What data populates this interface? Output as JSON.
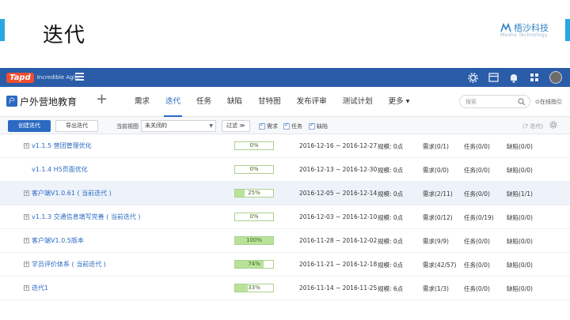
{
  "slide": {
    "title": "迭代",
    "brand_name": "梧沙科技",
    "brand_sub": "Mesha Technology"
  },
  "app": {
    "logo": "Tapd",
    "logo_tagline": "Incredible Agile",
    "project_icon": "户",
    "project_name": "户外营地教育",
    "plus": "+",
    "nav": [
      {
        "label": "需求",
        "active": false
      },
      {
        "label": "迭代",
        "active": true
      },
      {
        "label": "任务",
        "active": false
      },
      {
        "label": "缺陷",
        "active": false
      },
      {
        "label": "甘特图",
        "active": false
      },
      {
        "label": "发布评审",
        "active": false
      },
      {
        "label": "测试计划",
        "active": false
      },
      {
        "label": "更多 ▾",
        "active": false
      }
    ],
    "search_placeholder": "搜索",
    "guide": "⊙在线指引",
    "colors": {
      "topbar": "#2a5ca8",
      "accent": "#2a6ac2",
      "progress": "#b9e29a",
      "slide_accent": "#29a8e0"
    }
  },
  "toolbar": {
    "create_label": "创建迭代",
    "export_label": "导出迭代",
    "view_label": "当前视图",
    "view_value": "未关闭的",
    "filter_label": "过滤 ≫",
    "checks": [
      "需求",
      "任务",
      "缺陷"
    ],
    "count": "(7 迭代)"
  },
  "iterations": [
    {
      "name": "v1.1.5 营团管理优化",
      "expandable": true,
      "progress": "0%",
      "progress_value": 0,
      "dates": "2016-12-16 ~ 2016-12-27",
      "scale": "规模: 0点",
      "req": "需求(0/1)",
      "task": "任务(0/0)",
      "bug": "缺陷(0/0)",
      "highlight": false
    },
    {
      "name": "v1.1.4 H5页面优化",
      "expandable": false,
      "progress": "0%",
      "progress_value": 0,
      "dates": "2016-12-13 ~ 2016-12-30",
      "scale": "规模: 0点",
      "req": "需求(0/0)",
      "task": "任务(0/0)",
      "bug": "缺陷(0/0)",
      "highlight": false
    },
    {
      "name": "客户端V1.0.61 ( 当前迭代 )",
      "expandable": true,
      "progress": "25%",
      "progress_value": 25,
      "dates": "2016-12-05 ~ 2016-12-14",
      "scale": "规模: 0点",
      "req": "需求(2/11)",
      "task": "任务(0/0)",
      "bug": "缺陷(1/1)",
      "highlight": true
    },
    {
      "name": "v1.1.3 交通信息填写完善 ( 当前迭代 )",
      "expandable": true,
      "progress": "0%",
      "progress_value": 0,
      "dates": "2016-12-03 ~ 2016-12-10",
      "scale": "规模: 0点",
      "req": "需求(0/12)",
      "task": "任务(0/19)",
      "bug": "缺陷(0/0)",
      "highlight": false
    },
    {
      "name": "客户端V1.0.5版本",
      "expandable": true,
      "progress": "100%",
      "progress_value": 100,
      "dates": "2016-11-28 ~ 2016-12-02",
      "scale": "规模: 0点",
      "req": "需求(9/9)",
      "task": "任务(0/0)",
      "bug": "缺陷(0/0)",
      "highlight": false
    },
    {
      "name": "学员评价体系 ( 当前迭代 )",
      "expandable": true,
      "progress": "74%",
      "progress_value": 74,
      "dates": "2016-11-21 ~ 2016-12-18",
      "scale": "规模: 0点",
      "req": "需求(42/57)",
      "task": "任务(0/0)",
      "bug": "缺陷(0/0)",
      "highlight": false
    },
    {
      "name": "迭代1",
      "expandable": true,
      "progress": "33%",
      "progress_value": 33,
      "dates": "2016-11-14 ~ 2016-11-25",
      "scale": "规模: 6点",
      "req": "需求(1/3)",
      "task": "任务(0/0)",
      "bug": "缺陷(0/0)",
      "highlight": false
    }
  ]
}
